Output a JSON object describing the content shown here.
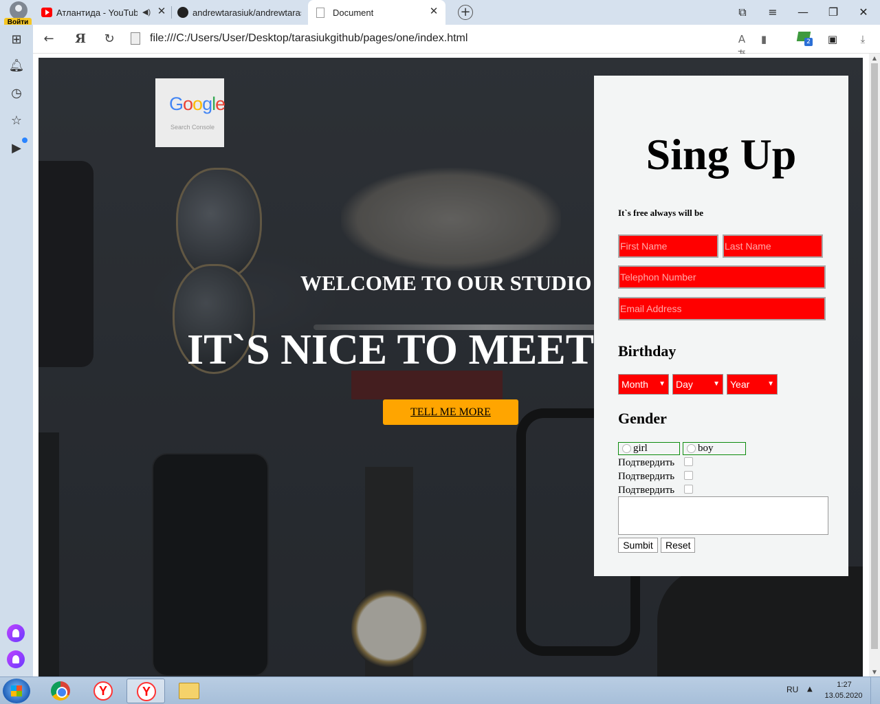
{
  "browser": {
    "profile_label": "Войти",
    "tabs": [
      {
        "title": "Атлантида - YouTube",
        "active": false
      },
      {
        "title": "andrewtarasiuk/andrewtarasiuk",
        "active": false
      },
      {
        "title": "Document",
        "active": true
      }
    ],
    "new_tab_symbol": "+",
    "close_symbol": "✕",
    "url": "file:///C:/Users/User/Desktop/tarasiukgithub/pages/one/index.html",
    "extension_badge": "2"
  },
  "sidebar": {
    "icons": [
      "apps-grid-icon",
      "bell-icon",
      "history-icon",
      "star-icon",
      "media-icon",
      "alice-icon",
      "alice-icon"
    ]
  },
  "page": {
    "logo": {
      "word_letters": [
        "G",
        "o",
        "o",
        "g",
        "l",
        "e"
      ],
      "subtitle": "Search Console"
    },
    "welcome": "WELCOME TO OUR STUDIO",
    "headline": "IT`S NICE TO MEET YOU",
    "cta_button": "TELL ME MORE",
    "cta_color": "#ffa500"
  },
  "signup": {
    "title": "Sing Up",
    "subtitle": "It`s free always will be",
    "first_name_placeholder": "First Name",
    "last_name_placeholder": "Last Name",
    "telephone_placeholder": "Telephon Number",
    "email_placeholder": "Email Address",
    "input_color": "#ff0000",
    "birthday_label": "Birthday",
    "month_select": "Month",
    "day_select": "Day",
    "year_select": "Year",
    "gender_label": "Gender",
    "gender_options": [
      "girl",
      "boy"
    ],
    "confirm_labels": [
      "Подтвердить",
      "Подтвердить",
      "Подтвердить"
    ],
    "submit_label": "Sumbit",
    "reset_label": "Reset"
  },
  "taskbar": {
    "language": "RU",
    "time": "1:27",
    "date": "13.05.2020"
  }
}
